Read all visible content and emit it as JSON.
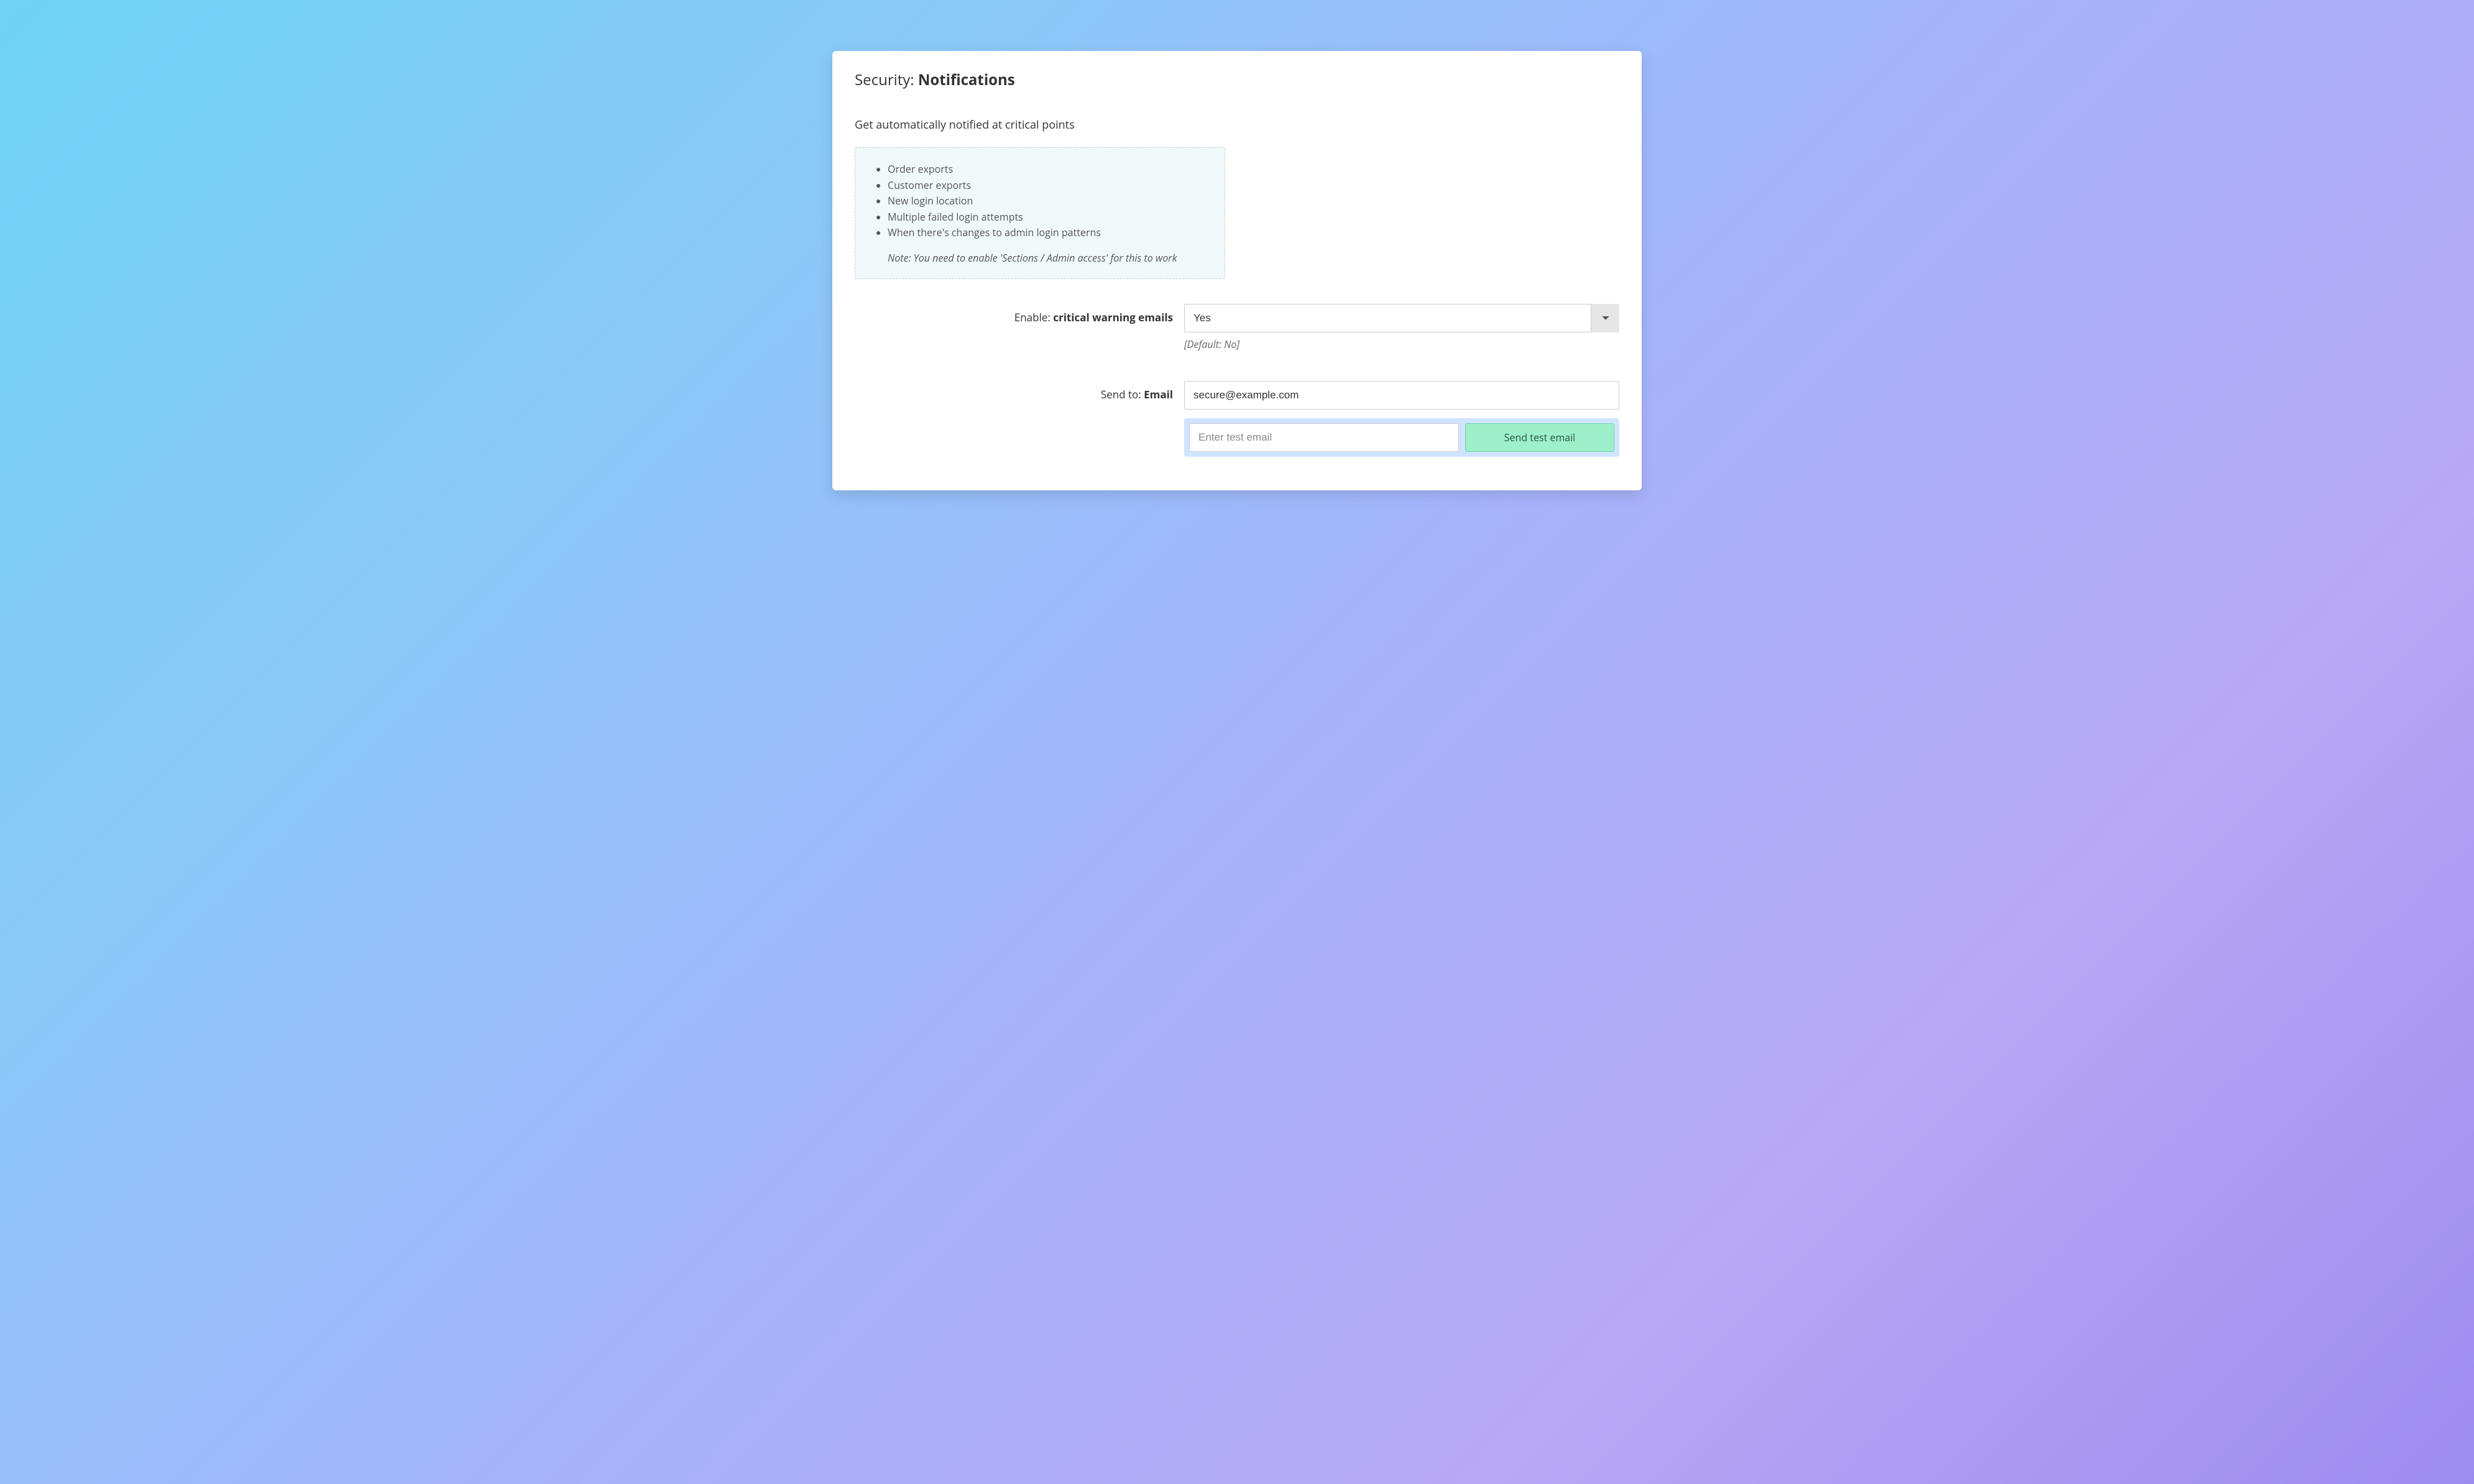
{
  "title": {
    "prefix": "Security: ",
    "bold": "Notifications"
  },
  "section": {
    "heading": "Get automatically notified at critical points"
  },
  "info": {
    "items": [
      "Order exports",
      "Customer exports",
      "New login location",
      "Multiple failed login attempts",
      "When there's changes to admin login patterns"
    ],
    "note": "Note: You need to enable 'Sections / Admin access' for this to work"
  },
  "form": {
    "enable": {
      "label_prefix": "Enable: ",
      "label_bold": "critical warning emails",
      "value": "Yes",
      "default_hint": "[Default: No]"
    },
    "sendto": {
      "label_prefix": "Send to: ",
      "label_bold": "Email",
      "value": "secure@example.com"
    },
    "test": {
      "placeholder": "Enter test email",
      "button": "Send test email"
    }
  }
}
